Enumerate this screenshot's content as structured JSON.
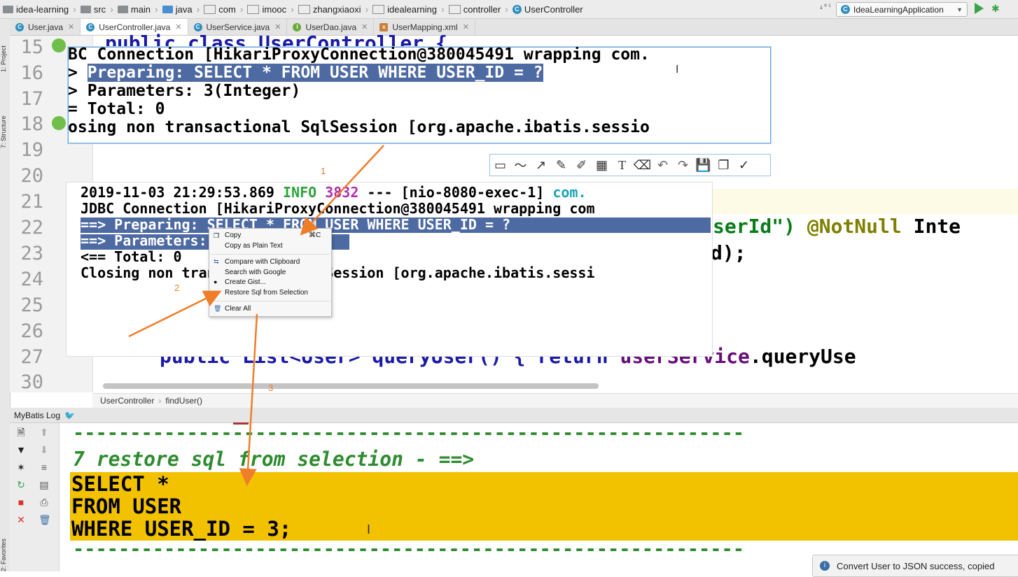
{
  "navbar": {
    "breadcrumbs": [
      "idea-learning",
      "src",
      "main",
      "java",
      "com",
      "imooc",
      "zhangxiaoxi",
      "idealearning",
      "controller",
      "UserController"
    ],
    "run_config": "IdeaLearningApplication"
  },
  "tabs": [
    {
      "label": "User.java",
      "icon": "C",
      "color": "#2f8fbd"
    },
    {
      "label": "UserController.java",
      "icon": "C",
      "color": "#2f8fbd"
    },
    {
      "label": "UserService.java",
      "icon": "C",
      "color": "#2f8fbd"
    },
    {
      "label": "UserDao.java",
      "icon": "I",
      "color": "#6aaa3a"
    },
    {
      "label": "UserMapping.xml",
      "icon": "x",
      "color": "#c9803b"
    }
  ],
  "left_strip": {
    "project": "1: Project",
    "structure": "7: Structure",
    "favorites": "2: Favorites"
  },
  "editor": {
    "line_numbers": [
      "15",
      "16",
      "17",
      "18",
      "19",
      "20",
      "21",
      "22",
      "23",
      "24",
      "25",
      "26",
      "27",
      "30"
    ],
    "line15": "public class UserController {",
    "line22_a": "serId\")",
    "line22_b": " @NotNull",
    "line22_c": " Inte",
    "line23": "d);",
    "line27_a": "public List<User> queryUser() { ",
    "line27_b": "return",
    "line27_c": " userService",
    "line27_d": ".queryUse",
    "breadcrumb_class": "UserController",
    "breadcrumb_method": "findUser()"
  },
  "shot_top": {
    "l1": "BC Connection [HikariProxyConnection@380045491 wrapping com.",
    "l2_prefix": ">  ",
    "l2_sel": "Preparing: SELECT * FROM USER WHERE USER_ID = ? ",
    "l3": "> Parameters: 3(Integer)",
    "l4": "=       Total: 0",
    "l5": "osing non transactional SqlSession [org.apache.ibatis.sessio"
  },
  "shot_mid": {
    "l1_ts": "2019-11-03 21:29:53.869  ",
    "l1_info": "INFO",
    "l1_pid": " 3832",
    "l1_rest": " --- [nio-8080-exec-1] ",
    "l1_com": "com.",
    "l2": "JDBC Connection [HikariProxyConnection@380045491 wrapping com",
    "l3": "==>  Preparing: SELECT * FROM USER WHERE USER_ID = ?",
    "l4": "==> Parameters: 3(Integer)",
    "l5": "<==      Total: 0",
    "l6": "Closing non transactional SqlSession [org.apache.ibatis.sessi"
  },
  "context_menu": {
    "copy": "Copy",
    "copy_shortcut": "⌘C",
    "copy_plain": "Copy as Plain Text",
    "compare": "Compare with Clipboard",
    "search": "Search with Google",
    "gist": "Create Gist...",
    "restore": "Restore Sql from Selection",
    "clear": "Clear All"
  },
  "annotations": {
    "n1": "1",
    "n2": "2",
    "n3": "3",
    "arrow_color": "#f07d2a"
  },
  "log_panel": {
    "title": "MyBatis Log",
    "dashes": "-----------------------------------------------------------",
    "restore_line": "7  restore sql from selection  - ==>",
    "sql1": "SELECT *",
    "sql2": " FROM USER",
    "sql3": " WHERE USER_ID = 3;",
    "highlight_color": "#f2c100"
  },
  "toast": {
    "text": "Convert User to JSON success, copied"
  }
}
